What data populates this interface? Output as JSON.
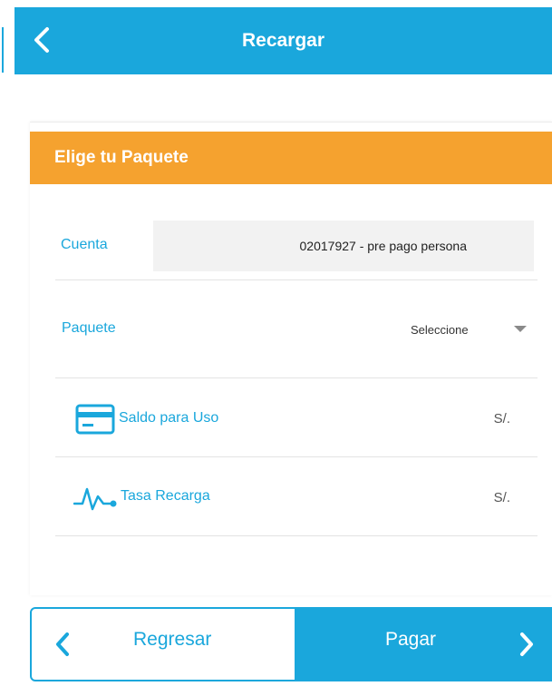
{
  "header": {
    "title": "Recargar",
    "back_icon": "chevron-left-icon"
  },
  "card": {
    "title": "Elige tu Paquete",
    "cuenta": {
      "label": "Cuenta",
      "value": "02017927 - pre pago persona"
    },
    "paquete": {
      "label": "Paquete",
      "selected": "Seleccione"
    },
    "items": [
      {
        "label": "Saldo para Uso",
        "value": "S/.",
        "icon": "credit-card-icon"
      },
      {
        "label": "Tasa Recarga",
        "value": "S/.",
        "icon": "pulse-icon"
      }
    ]
  },
  "footer": {
    "back_label": "Regresar",
    "pay_label": "Pagar"
  },
  "colors": {
    "primary": "#1aa7dc",
    "accent": "#f5a22f"
  }
}
